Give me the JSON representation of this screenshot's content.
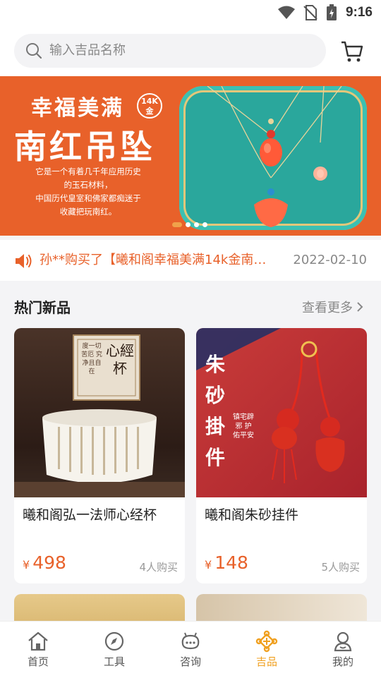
{
  "status_bar": {
    "time": "9:16"
  },
  "search": {
    "placeholder": "输入吉品名称"
  },
  "banner": {
    "title": "幸福美满",
    "badge_line1": "14K",
    "badge_line2": "金",
    "headline": "南红吊坠",
    "desc_lines": [
      "它是一个有着几千年应用历史",
      "的玉石材料，",
      "中国历代皇室和佛家都痴迷于",
      "收藏把玩南红。"
    ],
    "pages": 4,
    "active_page": 1
  },
  "notice": {
    "text": "孙**购买了【曦和阁幸福美满14k金南…",
    "date": "2022-02-10"
  },
  "section": {
    "title": "热门新品",
    "more": "查看更多"
  },
  "products": [
    {
      "name": "曦和阁弘一法师心经杯",
      "currency": "¥",
      "price": "498",
      "sold": "4人购买",
      "image_text": "心經杯",
      "image_subtext": "度一切苦厄 究净且自在"
    },
    {
      "name": "曦和阁朱砂挂件",
      "currency": "¥",
      "price": "148",
      "sold": "5人购买",
      "image_text": "朱砂掛件",
      "image_subtext": "镇宅辟邪 护佑平安"
    }
  ],
  "tabs": [
    {
      "label": "首页",
      "icon": "home-icon",
      "active": false
    },
    {
      "label": "工具",
      "icon": "compass-icon",
      "active": false
    },
    {
      "label": "咨询",
      "icon": "chat-icon",
      "active": false
    },
    {
      "label": "吉品",
      "icon": "knot-icon",
      "active": true
    },
    {
      "label": "我的",
      "icon": "user-icon",
      "active": false
    }
  ],
  "colors": {
    "accent": "#e8612a",
    "tab_active": "#f0a020",
    "banner_bg": "#e8612a"
  }
}
